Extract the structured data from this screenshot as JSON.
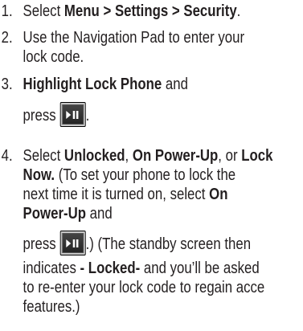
{
  "steps": [
    {
      "number": "1.",
      "lines": [
        {
          "pre": "Select ",
          "bold": "Menu > Settings > Security",
          "post": "."
        }
      ]
    },
    {
      "number": "2.",
      "lines": [
        {
          "text": "Use the Navigation Pad to enter your"
        },
        {
          "text": "lock code."
        }
      ]
    },
    {
      "number": "3.",
      "lines": [
        {
          "bold": "Highlight Lock Phone",
          "post": " and"
        },
        {
          "pre": "press",
          "post": "."
        }
      ]
    },
    {
      "number": "4.",
      "lines": [
        {
          "pre": "Select ",
          "bold1": "Unlocked",
          "mid": ", ",
          "bold2": "On Power-Up",
          "mid2": ", or ",
          "bold3": "Lock"
        },
        {
          "bold": "Now.",
          "post": " (To set your phone to lock the"
        },
        {
          "text": "next time it is turned on, select ",
          "bold": "On"
        },
        {
          "bold": "Power-Up",
          "post": " and"
        },
        {
          "pre": "press",
          "post": ".) (The standby screen then"
        },
        {
          "pre": "indicates ",
          "bold": "- Locked-",
          "post": " and you’ll be asked"
        },
        {
          "text": "to re-enter your lock code to regain acce"
        },
        {
          "text": "features.)"
        }
      ]
    }
  ],
  "key_icon": "play-pause-key-icon"
}
